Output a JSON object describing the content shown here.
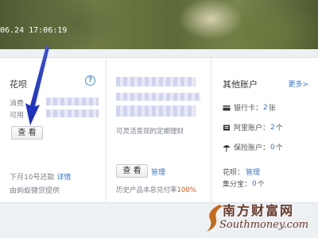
{
  "banner": {
    "timestamp": "06.24 17:06:19"
  },
  "huabei": {
    "title": "花呗",
    "help_label": "?",
    "line1_prefix": "消费",
    "line2_prefix": "可用",
    "view_button": "查 看",
    "repay_text": "下月10号还款",
    "repay_link": "详情",
    "provider_text": "由蚂蚁微贷提供"
  },
  "yuebao": {
    "desc": "可灵活变现的定期理财",
    "view_button": "查 看",
    "manage_link": "管理",
    "history_text": "历史产品本息兑付率",
    "history_rate": "100%",
    "accent": "#e0561b"
  },
  "other_accounts": {
    "title": "其他账户",
    "more_link": "更多>",
    "items": [
      {
        "label": "银行卡：",
        "value": "2",
        "unit": "张",
        "icon": "bank-card-icon"
      },
      {
        "label": "阿里账户：",
        "value": "2",
        "unit": "个",
        "icon": "ali-account-icon"
      },
      {
        "label": "保险账户：",
        "value": "0",
        "unit": "个",
        "icon": "umbrella-icon"
      }
    ],
    "huabei_label": "花呗：",
    "huabei_link": "管理",
    "jifenbao_label": "集分宝：",
    "jifenbao_value": "0",
    "jifenbao_unit": "个"
  },
  "watermark": {
    "cn": "南方财富网",
    "en": "Southmoney.com"
  }
}
